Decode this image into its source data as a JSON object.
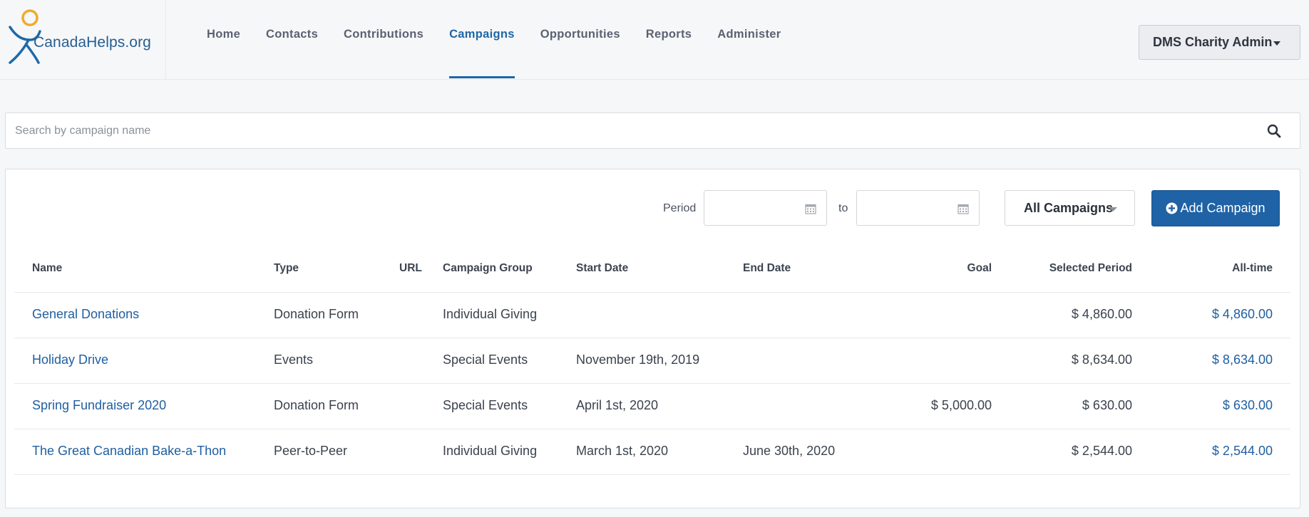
{
  "brand": {
    "logo_text_1": "Canada",
    "logo_text_2": "Helps",
    "logo_text_3": ".org"
  },
  "nav": {
    "items": [
      {
        "label": "Home"
      },
      {
        "label": "Contacts"
      },
      {
        "label": "Contributions"
      },
      {
        "label": "Campaigns",
        "active": true
      },
      {
        "label": "Opportunities"
      },
      {
        "label": "Reports"
      },
      {
        "label": "Administer"
      }
    ]
  },
  "user_menu": {
    "label": "DMS Charity Admin"
  },
  "search": {
    "placeholder": "Search by campaign name",
    "value": ""
  },
  "filters": {
    "period_label": "Period",
    "from_value": "",
    "to_label": "to",
    "to_value": "",
    "campaign_filter": "All Campaigns",
    "add_button": "Add Campaign"
  },
  "table": {
    "headers": {
      "name": "Name",
      "type": "Type",
      "url": "URL",
      "group": "Campaign Group",
      "start": "Start Date",
      "end": "End Date",
      "goal": "Goal",
      "selected": "Selected Period",
      "alltime": "All-time"
    },
    "rows": [
      {
        "name": "General Donations",
        "type": "Donation Form",
        "url": "",
        "group": "Individual Giving",
        "start": "",
        "end": "",
        "goal": "",
        "selected": "$ 4,860.00",
        "alltime": "$ 4,860.00"
      },
      {
        "name": "Holiday Drive",
        "type": "Events",
        "url": "",
        "group": "Special Events",
        "start": "November 19th, 2019",
        "end": "",
        "goal": "",
        "selected": "$ 8,634.00",
        "alltime": "$ 8,634.00"
      },
      {
        "name": "Spring Fundraiser 2020",
        "type": "Donation Form",
        "url": "",
        "group": "Special Events",
        "start": "April 1st, 2020",
        "end": "",
        "goal": "$ 5,000.00",
        "selected": "$ 630.00",
        "alltime": "$ 630.00"
      },
      {
        "name": "The Great Canadian Bake-a-Thon",
        "type": "Peer-to-Peer",
        "url": "",
        "group": "Individual Giving",
        "start": "March 1st, 2020",
        "end": "June 30th, 2020",
        "goal": "",
        "selected": "$ 2,544.00",
        "alltime": "$ 2,544.00"
      }
    ]
  },
  "colors": {
    "accent": "#1f66a6",
    "button_primary": "#1f62a5",
    "logo_orange": "#f2a92c"
  },
  "icons": {
    "search": "search-icon",
    "calendar": "calendar-icon",
    "add": "plus-circle-icon"
  }
}
